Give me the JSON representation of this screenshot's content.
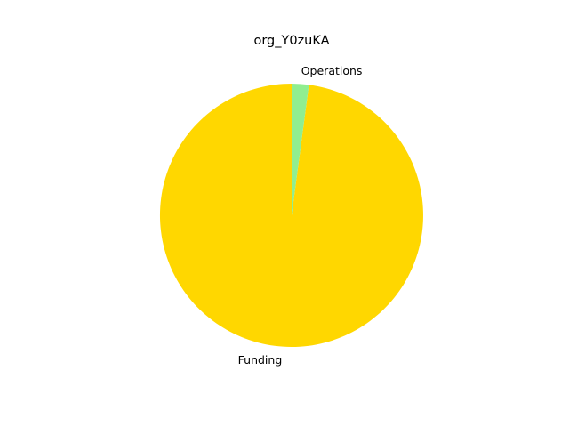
{
  "chart_data": {
    "type": "pie",
    "title": "org_Y0zuKA",
    "categories": [
      "Funding",
      "Operations"
    ],
    "values": [
      97.9,
      2.1
    ],
    "colors": [
      "#FFD700",
      "#90EE90"
    ],
    "start_angle_deg": 90,
    "direction": "counterclockwise",
    "legend": "none"
  }
}
